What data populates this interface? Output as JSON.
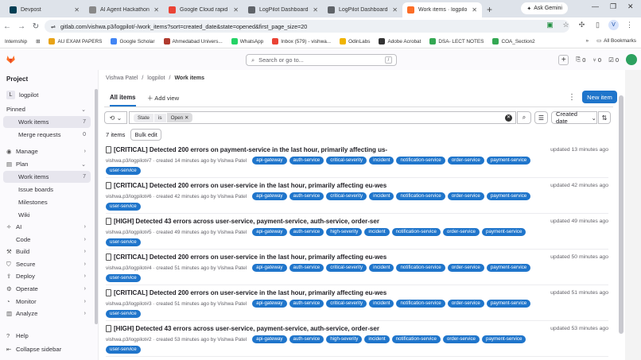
{
  "browser": {
    "tabs": [
      {
        "label": "Devpost",
        "color": "#003e54",
        "active": false
      },
      {
        "label": "AI Agent Hackathon |",
        "color": "#888888",
        "active": false
      },
      {
        "label": "Google Cloud rapid a",
        "color": "#ea4335",
        "active": false
      },
      {
        "label": "LogPilot Dashboard",
        "color": "#5f6368",
        "active": false
      },
      {
        "label": "LogPilot Dashboard",
        "color": "#5f6368",
        "active": false
      },
      {
        "label": "Work items · logpilo",
        "color": "#fc6d26",
        "active": true
      }
    ],
    "gemini_label": "Ask Gemini",
    "url": "gitlab.com/vishwa.p3/logpilot/-/work_items?sort=created_date&state=opened&first_page_size=20",
    "avatar_letter": "V",
    "bookmarks": [
      {
        "label": "Internship",
        "color": ""
      },
      {
        "label": "AU EXAM PAPERS",
        "color": "#e8a317"
      },
      {
        "label": "Google Scholar",
        "color": "#4285f4"
      },
      {
        "label": "Ahmedabad Univers...",
        "color": "#b03a2e"
      },
      {
        "label": "WhatsApp",
        "color": "#25d366"
      },
      {
        "label": "Inbox (579) - vishwa...",
        "color": "#ea4335"
      },
      {
        "label": "OdinLabs",
        "color": "#f0b400"
      },
      {
        "label": "Adobe Acrobat",
        "color": "#333333"
      },
      {
        "label": "DSA- LECT NOTES",
        "color": "#34a853"
      },
      {
        "label": "COA_Section2",
        "color": "#34a853"
      }
    ],
    "all_bookmarks": "All Bookmarks"
  },
  "gitlab": {
    "search_placeholder": "Search or go to...",
    "slash": "/",
    "counts": {
      "issues": "0",
      "mrs": "0",
      "todos": "0"
    }
  },
  "sidebar": {
    "section_title": "Project",
    "project_badge": "L",
    "project_name": "logpilot",
    "items": [
      {
        "label": "Pinned",
        "count": "",
        "chev": "⌄",
        "icon": "",
        "active": false,
        "sub": false
      },
      {
        "label": "Work items",
        "count": "7",
        "chev": "",
        "icon": "",
        "active": true,
        "sub": true
      },
      {
        "label": "Merge requests",
        "count": "0",
        "chev": "",
        "icon": "",
        "active": false,
        "sub": true
      },
      {
        "label": "Manage",
        "count": "",
        "chev": "›",
        "icon": "◉",
        "active": false,
        "sub": false
      },
      {
        "label": "Plan",
        "count": "",
        "chev": "⌄",
        "icon": "▤",
        "active": false,
        "sub": false
      },
      {
        "label": "Work items",
        "count": "7",
        "chev": "",
        "icon": "",
        "active": true,
        "sub": true
      },
      {
        "label": "Issue boards",
        "count": "",
        "chev": "",
        "icon": "",
        "active": false,
        "sub": true
      },
      {
        "label": "Milestones",
        "count": "",
        "chev": "",
        "icon": "",
        "active": false,
        "sub": true
      },
      {
        "label": "Wiki",
        "count": "",
        "chev": "",
        "icon": "",
        "active": false,
        "sub": true
      },
      {
        "label": "AI",
        "count": "",
        "chev": "›",
        "icon": "✧",
        "active": false,
        "sub": false
      },
      {
        "label": "Code",
        "count": "",
        "chev": "›",
        "icon": "</>",
        "active": false,
        "sub": false
      },
      {
        "label": "Build",
        "count": "",
        "chev": "›",
        "icon": "⚒",
        "active": false,
        "sub": false
      },
      {
        "label": "Secure",
        "count": "",
        "chev": "›",
        "icon": "⛉",
        "active": false,
        "sub": false
      },
      {
        "label": "Deploy",
        "count": "",
        "chev": "›",
        "icon": "⇪",
        "active": false,
        "sub": false
      },
      {
        "label": "Operate",
        "count": "",
        "chev": "›",
        "icon": "⚙",
        "active": false,
        "sub": false
      },
      {
        "label": "Monitor",
        "count": "",
        "chev": "›",
        "icon": "◔",
        "active": false,
        "sub": false
      },
      {
        "label": "Analyze",
        "count": "",
        "chev": "›",
        "icon": "▥",
        "active": false,
        "sub": false
      }
    ],
    "help": "Help",
    "collapse": "Collapse sidebar"
  },
  "main": {
    "breadcrumb": [
      "Vishwa Patel",
      "logpilot",
      "Work items"
    ],
    "view_tab": "All items",
    "add_view": "Add view",
    "new_item": "New item",
    "filter_tokens": [
      "State",
      "is",
      "Open"
    ],
    "sort_label": "Created date",
    "count_text": "7 items",
    "bulk_edit": "Bulk edit",
    "rows": [
      {
        "title": "[CRITICAL] Detected 200 errors on payment-service in the last hour, primarily affecting us-",
        "meta": "vishwa.p3/logpilot#7 · created 14 minutes ago by Vishwa Patel",
        "labels": [
          "api-gateway",
          "auth-service",
          "critical-severity",
          "incident",
          "notification-service",
          "order-service",
          "payment-service"
        ],
        "updated": "updated 13 minutes ago"
      },
      {
        "title": "[CRITICAL] Detected 200 errors on user-service in the last hour, primarily affecting eu-wes",
        "meta": "vishwa.p3/logpilot#6 · created 42 minutes ago by Vishwa Patel",
        "labels": [
          "api-gateway",
          "auth-service",
          "critical-severity",
          "incident",
          "notification-service",
          "order-service",
          "payment-service"
        ],
        "updated": "updated 42 minutes ago"
      },
      {
        "title": "[HIGH] Detected 43 errors across user-service, payment-service, auth-service, order-ser",
        "meta": "vishwa.p3/logpilot#5 · created 49 minutes ago by Vishwa Patel",
        "labels": [
          "api-gateway",
          "auth-service",
          "high-severity",
          "incident",
          "notification-service",
          "order-service",
          "payment-service"
        ],
        "updated": "updated 49 minutes ago"
      },
      {
        "title": "[CRITICAL] Detected 200 errors on user-service in the last hour, primarily affecting eu-wes",
        "meta": "vishwa.p3/logpilot#4 · created 51 minutes ago by Vishwa Patel",
        "labels": [
          "api-gateway",
          "auth-service",
          "critical-severity",
          "incident",
          "notification-service",
          "order-service",
          "payment-service"
        ],
        "updated": "updated 50 minutes ago"
      },
      {
        "title": "[CRITICAL] Detected 200 errors on user-service in the last hour, primarily affecting eu-wes",
        "meta": "vishwa.p3/logpilot#3 · created 51 minutes ago by Vishwa Patel",
        "labels": [
          "api-gateway",
          "auth-service",
          "critical-severity",
          "incident",
          "notification-service",
          "order-service",
          "payment-service"
        ],
        "updated": "updated 51 minutes ago"
      },
      {
        "title": "[HIGH] Detected 43 errors across user-service, payment-service, auth-service, order-ser",
        "meta": "vishwa.p3/logpilot#2 · created 53 minutes ago by Vishwa Patel",
        "labels": [
          "api-gateway",
          "auth-service",
          "high-severity",
          "incident",
          "notification-service",
          "order-service",
          "payment-service"
        ],
        "updated": "updated 53 minutes ago"
      }
    ],
    "row_extra_label": "user-service"
  },
  "colors": {
    "label_blue": "#1f75cb",
    "gitlab_orange": "#fc6d26"
  }
}
